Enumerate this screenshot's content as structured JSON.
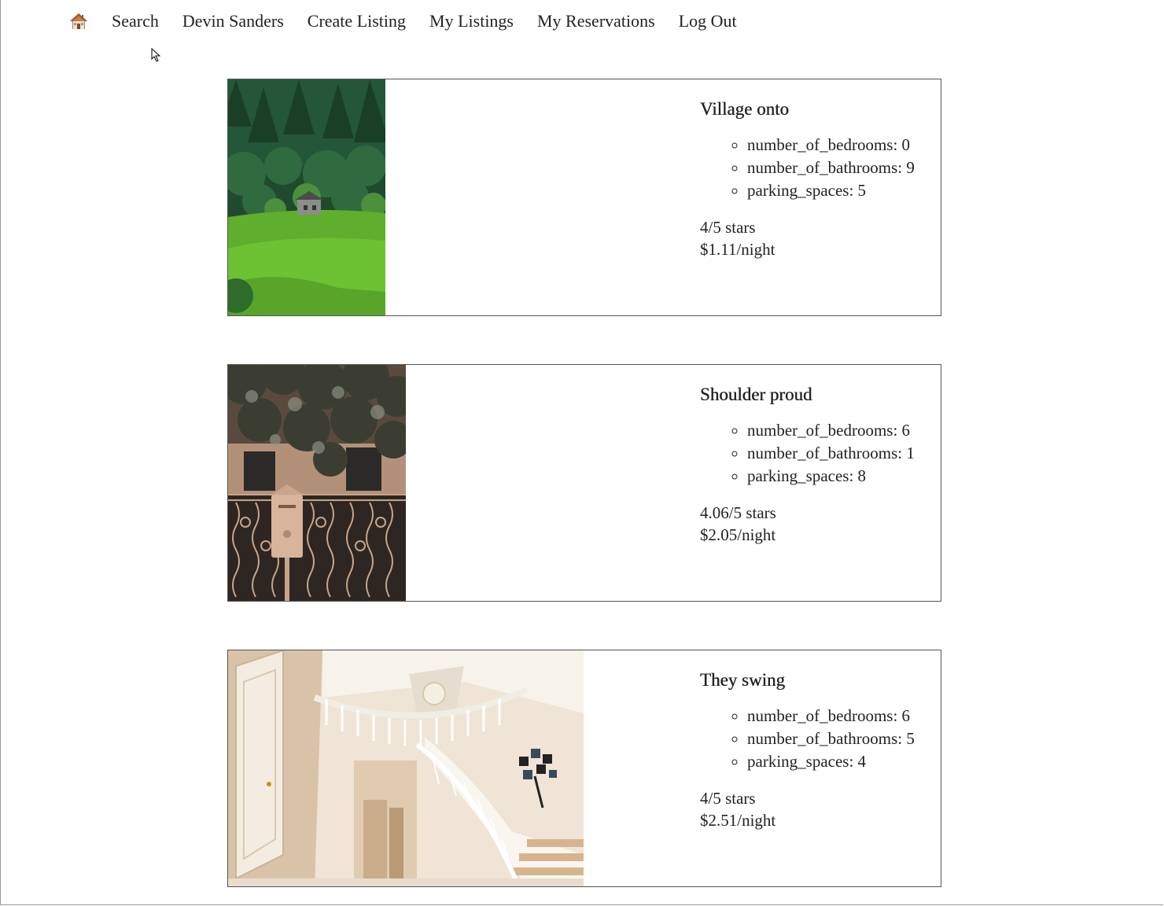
{
  "nav": {
    "home_icon": "house-icon",
    "items": [
      {
        "label": "Search"
      },
      {
        "label": "Devin Sanders"
      },
      {
        "label": "Create Listing"
      },
      {
        "label": "My Listings"
      },
      {
        "label": "My Reservations"
      },
      {
        "label": "Log Out"
      }
    ]
  },
  "listings": [
    {
      "title": "Village onto",
      "photo": "forest-hillside-cabin-photo",
      "features": [
        "number_of_bedrooms: 0",
        "number_of_bathrooms: 9",
        "parking_spaces: 5"
      ],
      "rating": "4/5 stars",
      "price": "$1.11/night"
    },
    {
      "title": "Shoulder proud",
      "photo": "mailbox-iron-gate-photo",
      "features": [
        "number_of_bedrooms: 6",
        "number_of_bathrooms: 1",
        "parking_spaces: 8"
      ],
      "rating": "4.06/5 stars",
      "price": "$2.05/night"
    },
    {
      "title": "They swing",
      "photo": "foyer-staircase-photo",
      "features": [
        "number_of_bedrooms: 6",
        "number_of_bathrooms: 5",
        "parking_spaces: 4"
      ],
      "rating": "4/5 stars",
      "price": "$2.51/night"
    }
  ]
}
